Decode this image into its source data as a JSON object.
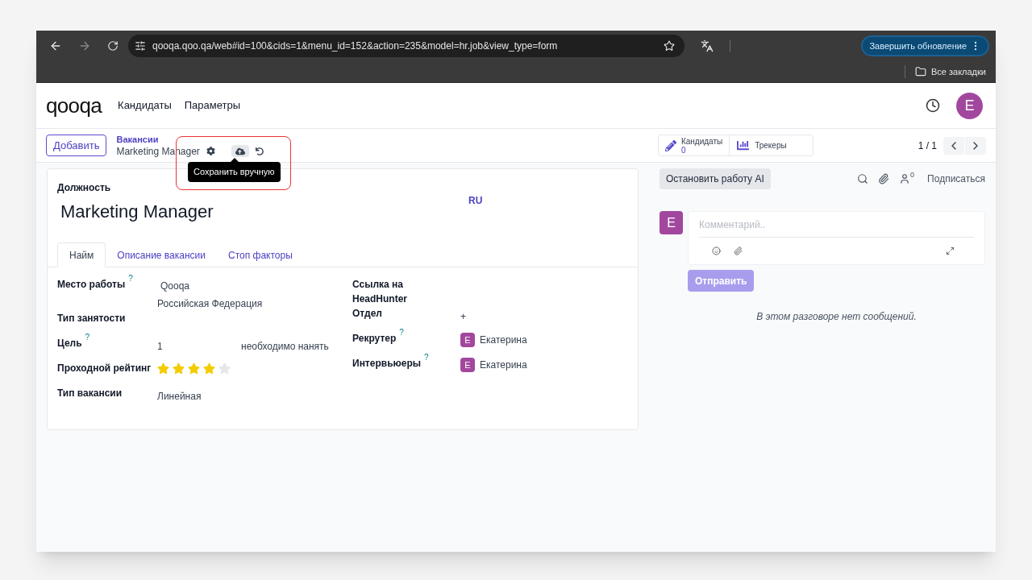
{
  "browser": {
    "url": "qooqa.qoo.qa/web#id=100&cids=1&menu_id=152&action=235&model=hr.job&view_type=form",
    "update_button": "Завершить обновление",
    "bookmarks": "Все закладки"
  },
  "app": {
    "logo": "qooqa",
    "menu": [
      "Кандидаты",
      "Параметры"
    ],
    "avatar": "E"
  },
  "control_panel": {
    "add_button": "Добавить",
    "breadcrumb": "Вакансии",
    "record": "Marketing Manager",
    "tooltip": "Сохранить вручную",
    "smart_buttons": [
      {
        "kind": "pencil",
        "label": "Кандидаты",
        "value": "0"
      },
      {
        "kind": "chart",
        "label": "Трекеры"
      }
    ],
    "pager": "1 / 1"
  },
  "form": {
    "title_label": "Должность",
    "title": "Marketing Manager",
    "lang": "RU",
    "tabs": [
      {
        "label": "Найм",
        "selected": true
      },
      {
        "label": "Описание вакансии",
        "selected": false
      },
      {
        "label": "Стоп факторы",
        "selected": false
      }
    ],
    "left_fields": [
      {
        "kind": "lines",
        "label": "Место работы",
        "help": "?",
        "values": [
          "Qooqa",
          "Российская Федерация"
        ]
      },
      {
        "kind": "empty",
        "label": "Тип занятости"
      },
      {
        "kind": "text",
        "label": "Цель",
        "help": "?",
        "value": "1",
        "suffix": "необходимо нанять"
      },
      {
        "kind": "stars",
        "label": "Проходной рейтинг",
        "stars": 4
      },
      {
        "kind": "text",
        "label": "Тип вакансии",
        "value": "Линейная"
      }
    ],
    "right_fields": [
      {
        "kind": "empty",
        "label": "Ссылка на HeadHunter"
      },
      {
        "kind": "text",
        "label": "Отдел",
        "value": "+"
      },
      {
        "kind": "user",
        "label": "Рекрутер",
        "help": "?",
        "avatar": "E",
        "value": "Екатерина"
      },
      {
        "kind": "user",
        "label": "Интервьюеры",
        "help": "?",
        "avatar": "E",
        "value": "Екатерина"
      }
    ]
  },
  "chatter": {
    "stop_ai_button": "Остановить работу AI",
    "followers": "0",
    "subscribe": "Подписаться",
    "avatar": "E",
    "placeholder": "Комментарий..",
    "send_button": "Отправить",
    "empty": "В этом разговоре нет сообщений."
  }
}
